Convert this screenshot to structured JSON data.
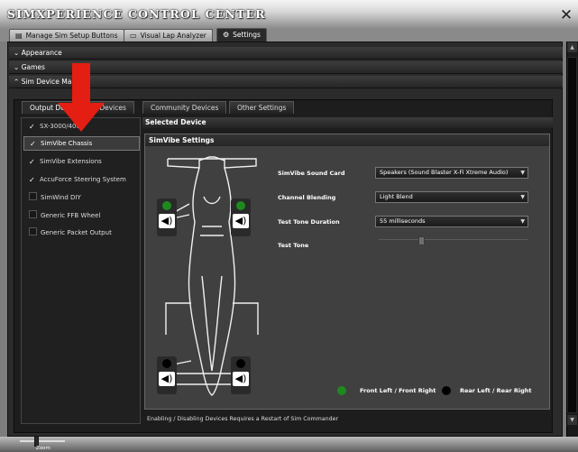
{
  "app": {
    "title": "SIMXPERIENCE CONTROL CENTER",
    "close_glyph": "✕"
  },
  "top_tabs": [
    {
      "label": "Manage Sim Setup Buttons",
      "icon": "sliders-icon",
      "glyph": "▤",
      "active": false
    },
    {
      "label": "Visual Lap Analyzer",
      "icon": "document-icon",
      "glyph": "▭",
      "active": false
    },
    {
      "label": "Settings",
      "icon": "gears-icon",
      "glyph": "⚙",
      "active": true
    }
  ],
  "sections": [
    {
      "label": "Appearance",
      "expanded": false,
      "chevron": "⌄"
    },
    {
      "label": "Games",
      "expanded": false,
      "chevron": "⌄"
    },
    {
      "label": "Sim Device Ma",
      "expanded": true,
      "chevron": "⌃"
    }
  ],
  "sub_tabs": [
    {
      "label": "Output De",
      "active": true
    },
    {
      "label": "t Devices",
      "active": false
    },
    {
      "label": "Community Devices",
      "active": false
    },
    {
      "label": "Other Settings",
      "active": false
    }
  ],
  "devices": [
    {
      "label": "SX-3000/4000",
      "checked": true,
      "selected": false
    },
    {
      "label": "SimVibe Chassis",
      "checked": true,
      "selected": true
    },
    {
      "label": "SimVibe Extensions",
      "checked": true,
      "selected": false
    },
    {
      "label": "AccuForce Steering System",
      "checked": true,
      "selected": false
    },
    {
      "label": "SimWind DIY",
      "checked": false,
      "selected": false
    },
    {
      "label": "Generic FFB Wheel",
      "checked": false,
      "selected": false
    },
    {
      "label": "Generic Packet Output",
      "checked": false,
      "selected": false
    }
  ],
  "check_glyph": "✓",
  "selected_device_header": "Selected Device",
  "simvibe": {
    "header": "SimVibe Settings",
    "sound_card_label": "SimVibe Sound Card",
    "sound_card_value": "Speakers (Sound Blaster X-Fi Xtreme Audio)",
    "channel_blending_label": "Channel Blending",
    "channel_blending_value": "Light Blend",
    "test_tone_duration_label": "Test Tone Duration",
    "test_tone_duration_value": "55 milliseconds",
    "test_tone_label": "Test Tone",
    "test_tone_level": 0.28,
    "dropdown_arrow": "▼"
  },
  "legend": {
    "front_label": "Front Left / Front Right",
    "front_color": "#1e8a1e",
    "rear_label": "Rear Left / Rear Right",
    "rear_color": "#000000"
  },
  "footnote": "Enabling / Disabling Devices Requires a Restart of Sim Commander",
  "zoom": {
    "label": "Zoom",
    "level": 0.35
  },
  "accent_color": "#e41e12",
  "scroll_up": "▲",
  "scroll_down": "▼"
}
